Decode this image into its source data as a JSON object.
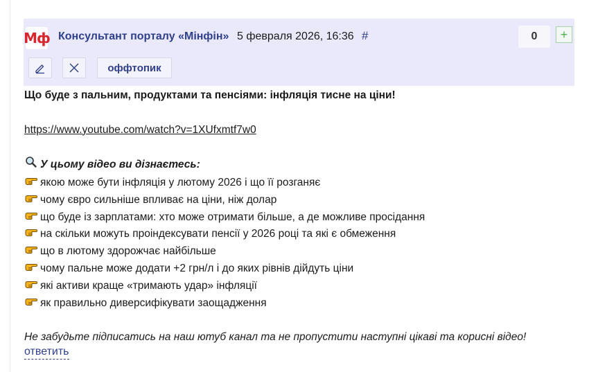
{
  "post": {
    "logo_text": "Мф",
    "author": "Консультант порталу «Мінфін»",
    "date": "5 февраля 2026, 16:36",
    "permalink_symbol": "#",
    "vote_count": "0",
    "vote_plus": "+",
    "tag_label": "оффтопик",
    "title": "Що буде з пальним, продуктами та пенсіями: інфляція тисне на ціни!",
    "link": "https://www.youtube.com/watch?v=1XUfxmtf7w0",
    "section_heading": "У цьому відео ви дізнаєтесь:",
    "bullets": [
      "якою може бути інфляція у лютому 2026 і що її розганяє",
      "чому євро сильніше впливає на ціни, ніж долар",
      "що буде із зарплатами: хто може отримати більше, а де можливе просідання",
      "на скільки можуть проіндексувати пенсії у 2026 році та які є обмеження",
      "що в лютому здорожчає найбільше",
      "чому пальне може додати +2 грн/л і до яких рівнів дійдуть ціни",
      "які активи краще «тримають удар» інфляції",
      "як правильно диверсифікувати заощадження"
    ],
    "outro": "Не забудьте підписатись на наш ютуб канал та не пропустити наступні цікаві та корисні відео!",
    "reply_label": "ответить"
  },
  "icons": {
    "edit": "pencil-icon",
    "delete": "close-icon",
    "heading": "magnifier-emoji",
    "bullet": "pointing-hand-emoji"
  },
  "colors": {
    "header_bg": "#e9e9fb",
    "link_blue": "#2f3f8c",
    "brand_red": "#d8262e",
    "plus_green": "#4caf50"
  }
}
